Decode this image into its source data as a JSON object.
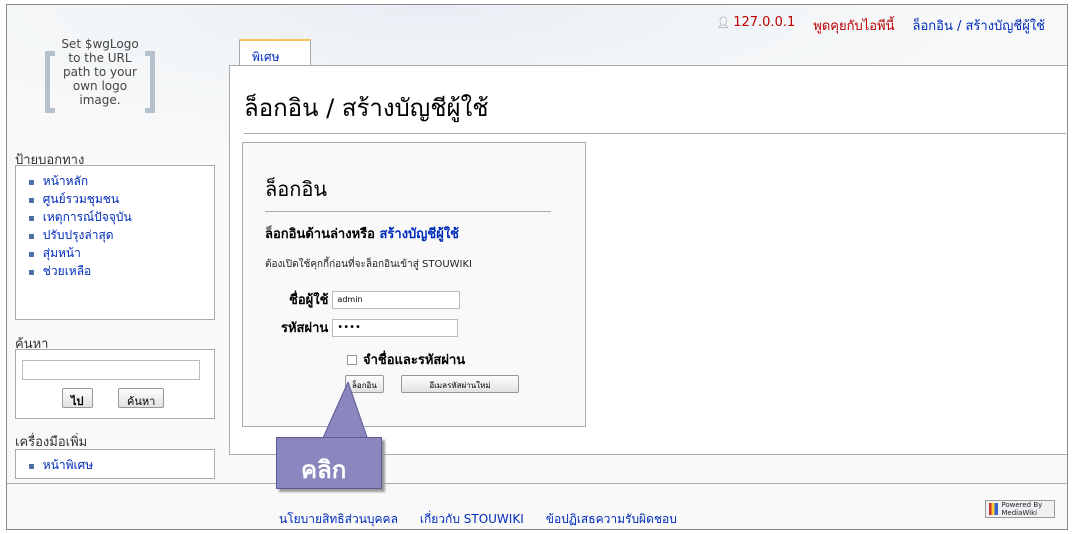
{
  "logo": {
    "text": "Set $wgLogo to the URL path to your own logo image."
  },
  "personal_tools": {
    "ip": "127.0.0.1",
    "talk": "พูดคุยกับไอพีนี้",
    "login": "ล็อกอิน / สร้างบัญชีผู้ใช้"
  },
  "tab": {
    "label": "พิเศษ"
  },
  "page": {
    "title": "ล็อกอิน / สร้างบัญชีผู้ใช้"
  },
  "login_form": {
    "heading": "ล็อกอิน",
    "intro": "ล็อกอินด้านล่างหรือ",
    "create_account": "สร้างบัญชีผู้ใช้",
    "cookie_notice": "ต้องเปิดใช้คุกกี้ก่อนที่จะล็อกอินเข้าสู่ STOUWIKI",
    "username_label": "ชื่อผู้ใช้",
    "username_value": "admin",
    "password_label": "รหัสผ่าน",
    "password_value": "••••",
    "remember_label": "จำชื่อและรหัสผ่าน",
    "login_button": "ล็อกอิน",
    "mail_password_button": "อีเมลรหัสผ่านใหม่"
  },
  "sidebar": {
    "nav_heading": "ป้ายบอกทาง",
    "nav_items": [
      {
        "label": "หน้าหลัก"
      },
      {
        "label": "ศูนย์รวมชุมชน"
      },
      {
        "label": "เหตุการณ์ปัจจุบัน"
      },
      {
        "label": "ปรับปรุงล่าสุด"
      },
      {
        "label": "สุ่มหน้า"
      },
      {
        "label": "ช่วยเหลือ"
      }
    ],
    "search_heading": "ค้นหา",
    "go_button": "ไป",
    "search_button": "ค้นหา",
    "tools_heading": "เครื่องมือเพิ่ม",
    "tools_items": [
      {
        "label": "หน้าพิเศษ"
      }
    ]
  },
  "footer": {
    "links": [
      {
        "label": "นโยบายสิทธิส่วนบุคคล"
      },
      {
        "label": "เกี่ยวกับ STOUWIKI"
      },
      {
        "label": "ข้อปฏิเสธความรับผิดชอบ"
      }
    ],
    "powered_by": "Powered By MediaWiki"
  },
  "annotation": {
    "callout": "คลิก"
  }
}
